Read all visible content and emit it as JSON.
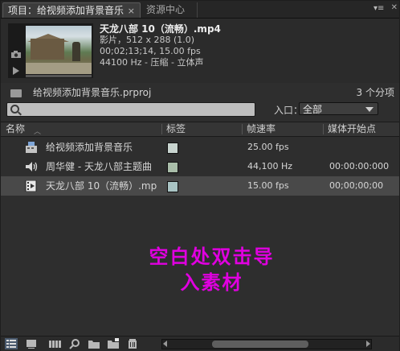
{
  "tabs": [
    {
      "label": "项目：给视频添加背景音乐",
      "close": "×"
    },
    {
      "label": "资源中心"
    }
  ],
  "preview": {
    "filename": "天龙八部 10（流畅）.mp4",
    "line1": "影片，512 x 288 (1.0)",
    "line2": "00;02;13;14, 15.00 fps",
    "line3": "44100 Hz - 压缩 - 立体声"
  },
  "project": {
    "name": "给视频添加背景音乐.prproj",
    "count": "3 个分项"
  },
  "filter": {
    "search_placeholder": "",
    "in_label": "入口：",
    "in_value": "全部"
  },
  "columns": {
    "name": "名称",
    "label": "标签",
    "fps": "帧速率",
    "start": "媒体开始点"
  },
  "items": [
    {
      "name": "给视频添加背景音乐",
      "icon": "sequence-icon",
      "color": "#c8d4cf",
      "fps": "25.00 fps",
      "start": ""
    },
    {
      "name": "周华健 - 天龙八部主题曲",
      "icon": "audio-icon",
      "color": "#a9bda9",
      "fps": "44,100 Hz",
      "start": "00:00:00:000"
    },
    {
      "name": "天龙八部 10（流畅）.mp",
      "icon": "video-icon",
      "color": "#a9c4c4",
      "fps": "15.00 fps",
      "start": "00;00;00;00"
    }
  ],
  "hint": {
    "line1": "空白处双击导",
    "line2": "入素材",
    "color": "#e000e0"
  }
}
